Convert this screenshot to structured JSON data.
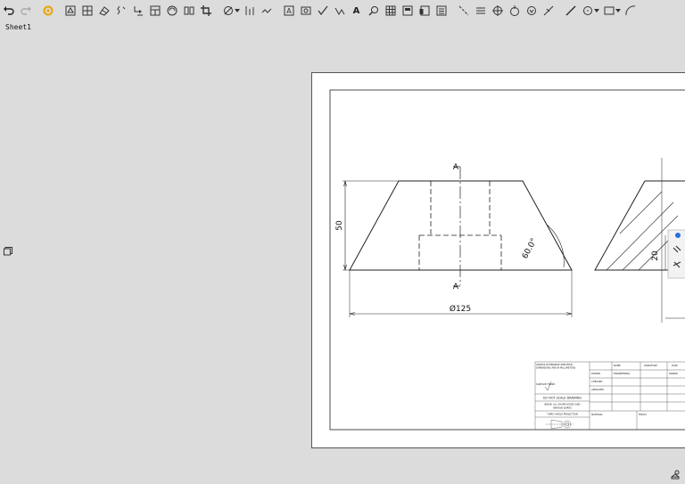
{
  "toolbar": {
    "text_tool": "A"
  },
  "sheet": {
    "name": "Sheet1"
  },
  "drawing": {
    "section_label_top": "A",
    "section_label_bottom": "A",
    "dim_height": "50",
    "dim_angle": "60.0°",
    "dim_diameter": "Ø125",
    "dim_right_height": "20"
  },
  "title_block": {
    "note_line1": "UNLESS OTHERWISE SPECIFIED:",
    "note_line2": "DIMENSIONS ARE IN MILLIMETERS",
    "note_line3": "SURFACE FINISH:",
    "name_header": "NAME",
    "signature_header": "SIGNATURE",
    "date_header": "DATE",
    "drawn": "DRAWN",
    "checked": "CHECKED",
    "approved": "APPROVED",
    "drawn_name": "ENGINEERING",
    "drawn_sig": "SIGNED",
    "do_not_scale": "DO NOT SCALE DRAWING",
    "break_edges": "BREAK ALL SHARP EDGES AND",
    "deburr": "REMOVE BURRS",
    "projection": "THIRD ANGLE PROJECTION",
    "material_label": "MATERIAL",
    "finish_label": "FINISH"
  }
}
